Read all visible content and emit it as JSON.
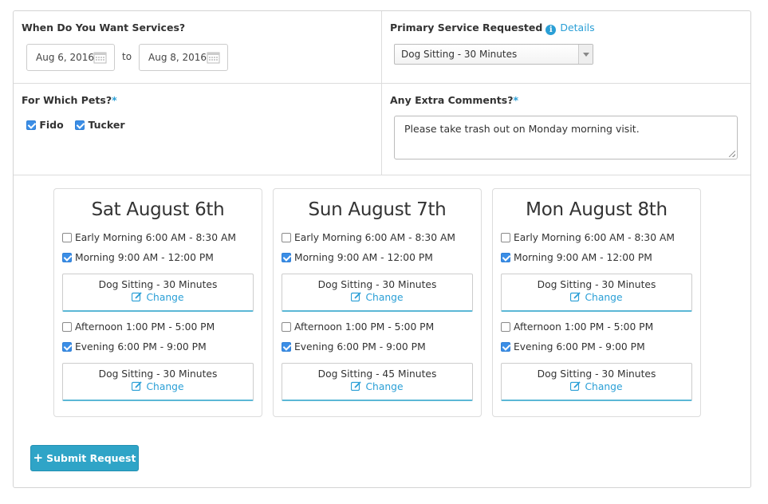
{
  "when": {
    "label": "When Do You Want Services?",
    "from_date": "Aug 6, 2016",
    "to_label": "to",
    "to_date": "Aug 8, 2016"
  },
  "primary_service": {
    "label": "Primary Service Requested",
    "details_link": "Details",
    "selected": "Dog Sitting - 30 Minutes"
  },
  "pets": {
    "label": "For Which Pets?",
    "required_mark": "*",
    "items": [
      {
        "name": "Fido",
        "checked": true
      },
      {
        "name": "Tucker",
        "checked": true
      }
    ]
  },
  "comments": {
    "label": "Any Extra Comments?",
    "required_mark": "*",
    "value": "Please take trash out on Monday morning visit."
  },
  "days": [
    {
      "title": "Sat August 6th",
      "slots": [
        {
          "label": "Early Morning 6:00 AM - 8:30 AM",
          "checked": false
        },
        {
          "label": "Morning 9:00 AM - 12:00 PM",
          "checked": true,
          "service": "Dog Sitting - 30 Minutes",
          "change": "Change"
        },
        {
          "label": "Afternoon 1:00 PM - 5:00 PM",
          "checked": false
        },
        {
          "label": "Evening 6:00 PM - 9:00 PM",
          "checked": true,
          "service": "Dog Sitting - 30 Minutes",
          "change": "Change"
        }
      ]
    },
    {
      "title": "Sun August 7th",
      "slots": [
        {
          "label": "Early Morning 6:00 AM - 8:30 AM",
          "checked": false
        },
        {
          "label": "Morning 9:00 AM - 12:00 PM",
          "checked": true,
          "service": "Dog Sitting - 30 Minutes",
          "change": "Change"
        },
        {
          "label": "Afternoon 1:00 PM - 5:00 PM",
          "checked": false
        },
        {
          "label": "Evening 6:00 PM - 9:00 PM",
          "checked": true,
          "service": "Dog Sitting - 45 Minutes",
          "change": "Change"
        }
      ]
    },
    {
      "title": "Mon August 8th",
      "slots": [
        {
          "label": "Early Morning 6:00 AM - 8:30 AM",
          "checked": false
        },
        {
          "label": "Morning 9:00 AM - 12:00 PM",
          "checked": true,
          "service": "Dog Sitting - 30 Minutes",
          "change": "Change"
        },
        {
          "label": "Afternoon 1:00 PM - 5:00 PM",
          "checked": false
        },
        {
          "label": "Evening 6:00 PM - 9:00 PM",
          "checked": true,
          "service": "Dog Sitting - 30 Minutes",
          "change": "Change"
        }
      ]
    }
  ],
  "submit": {
    "label": "Submit Request"
  },
  "colors": {
    "accent": "#2a9fd6",
    "checkbox": "#3b8ee6",
    "submit": "#2fa4c7"
  }
}
